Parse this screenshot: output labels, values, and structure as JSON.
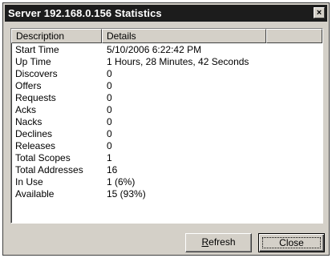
{
  "window": {
    "title": "Server 192.168.0.156 Statistics",
    "close_glyph": "×"
  },
  "listview": {
    "columns": [
      "Description",
      "Details",
      ""
    ],
    "rows": [
      {
        "desc": "Start Time",
        "val": "5/10/2006 6:22:42 PM"
      },
      {
        "desc": "Up Time",
        "val": "1 Hours, 28 Minutes, 42 Seconds"
      },
      {
        "desc": "Discovers",
        "val": "0"
      },
      {
        "desc": "Offers",
        "val": "0"
      },
      {
        "desc": "Requests",
        "val": "0"
      },
      {
        "desc": "Acks",
        "val": "0"
      },
      {
        "desc": "Nacks",
        "val": "0"
      },
      {
        "desc": "Declines",
        "val": "0"
      },
      {
        "desc": "Releases",
        "val": "0"
      },
      {
        "desc": "Total Scopes",
        "val": "1"
      },
      {
        "desc": "Total Addresses",
        "val": "16"
      },
      {
        "desc": "In Use",
        "val": "1 (6%)"
      },
      {
        "desc": "Available",
        "val": "15 (93%)"
      }
    ]
  },
  "buttons": {
    "refresh_mnemonic": "R",
    "refresh_rest": "efresh",
    "close": "Close"
  }
}
